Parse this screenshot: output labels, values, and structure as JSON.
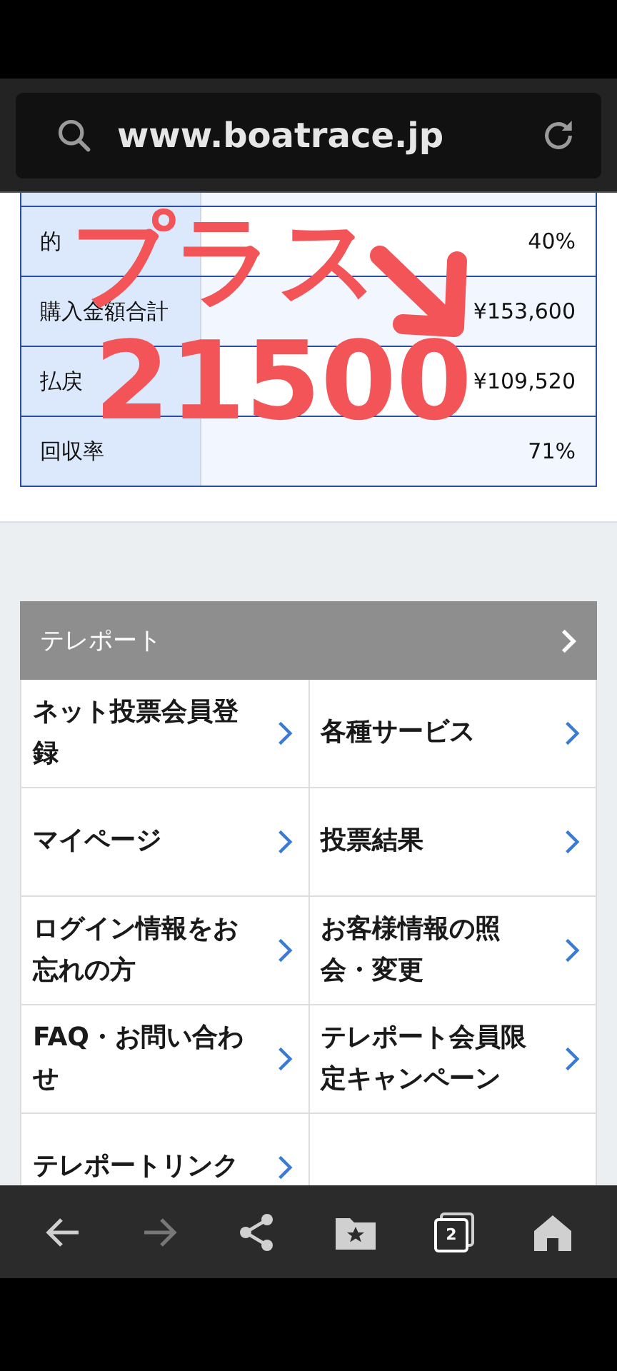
{
  "address_bar": {
    "url": "www.boatrace.jp"
  },
  "stats_table": {
    "rows": [
      {
        "label": "",
        "value": ""
      },
      {
        "label": "的",
        "value": "40%"
      },
      {
        "label": "購入金額合計",
        "value": "¥153,600"
      },
      {
        "label": "払戻",
        "value": "¥109,520"
      },
      {
        "label": "回収率",
        "value": "71%"
      }
    ]
  },
  "annotation": {
    "lines": [
      "プラス",
      "21500"
    ]
  },
  "menu": {
    "title": "テレポート",
    "items": [
      {
        "label": "ネット投票会員登録"
      },
      {
        "label": "各種サービス"
      },
      {
        "label": "マイページ"
      },
      {
        "label": "投票結果"
      },
      {
        "label": "ログイン情報をお忘れの方"
      },
      {
        "label": "お客様情報の照会・変更"
      },
      {
        "label": "FAQ・お問い合わせ"
      },
      {
        "label": "テレポート会員限定キャンペーン"
      },
      {
        "label": "テレポートリンク"
      }
    ]
  },
  "bottom_nav": {
    "items": [
      {
        "kind": "back",
        "disabled": false
      },
      {
        "kind": "forward",
        "disabled": true
      },
      {
        "kind": "share",
        "disabled": false
      },
      {
        "kind": "bookmarks",
        "disabled": false
      },
      {
        "kind": "tabs",
        "disabled": false,
        "count": "2"
      },
      {
        "kind": "home",
        "disabled": false
      }
    ]
  }
}
